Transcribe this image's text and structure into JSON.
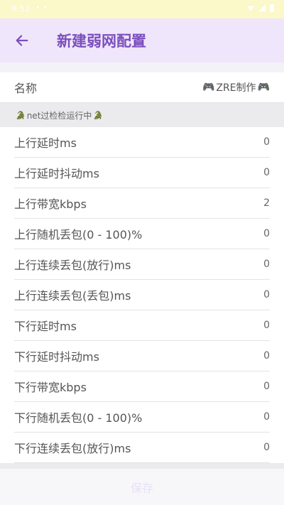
{
  "status_bar": {
    "time": "8:52",
    "dots": "• •"
  },
  "header": {
    "title": "新建弱网配置"
  },
  "name_row": {
    "label": "名称",
    "value": "ZRE制作"
  },
  "section": {
    "title": "net过检检运行中"
  },
  "rows": [
    {
      "label": "上行延时ms",
      "value": "0"
    },
    {
      "label": "上行延时抖动ms",
      "value": "0"
    },
    {
      "label": "上行带宽kbps",
      "value": "2"
    },
    {
      "label": "上行随机丢包(0 - 100)%",
      "value": "0"
    },
    {
      "label": "上行连续丢包(放行)ms",
      "value": "0"
    },
    {
      "label": "上行连续丢包(丢包)ms",
      "value": "0"
    },
    {
      "label": "下行延时ms",
      "value": "0"
    },
    {
      "label": "下行延时抖动ms",
      "value": "0"
    },
    {
      "label": "下行带宽kbps",
      "value": "0"
    },
    {
      "label": "下行随机丢包(0 - 100)%",
      "value": "0"
    },
    {
      "label": "下行连续丢包(放行)ms",
      "value": "0"
    }
  ],
  "footer": {
    "save_label": "保存"
  },
  "icons": {
    "back": "arrow-left-icon",
    "gamepad": "gamepad-icon",
    "section_marker": "animal-icon"
  },
  "colors": {
    "accent": "#7b4fbd",
    "appbar": "#f0e6fb",
    "status_bar": "#fbf8c9"
  }
}
